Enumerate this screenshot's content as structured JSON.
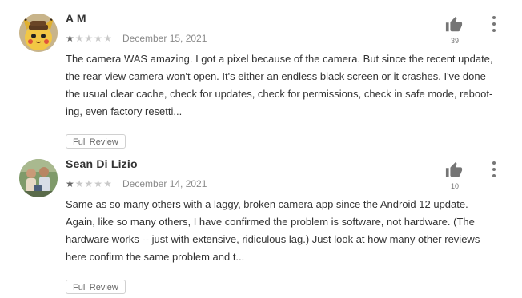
{
  "reviews": [
    {
      "author": "A M",
      "rating": 1,
      "stars": [
        "★",
        "★",
        "★",
        "★",
        "★"
      ],
      "date": "December 15, 2021",
      "text": "The camera WAS amazing. I got a pixel because of the camera. But since the recent update, the rear-view camera won't open. It's either an endless black screen or it crashes. I've done the usual clear cache, check for updates, check for permissions, check in safe mode, reboot-ing, even factory resetti...",
      "helpful_count": "39",
      "full_review_label": "Full Review",
      "avatar_icon": "pikachu-avatar-icon"
    },
    {
      "author": "Sean Di Lizio",
      "rating": 1,
      "stars": [
        "★",
        "★",
        "★",
        "★",
        "★"
      ],
      "date": "December 14, 2021",
      "text": "Same as so many others with a laggy, broken camera app since the Android 12 update. Again, like so many others, I have confirmed the problem is software, not hardware. (The hardware works -- just with extensive, ridiculous lag.) Just look at how many other reviews here confirm the same problem and t...",
      "helpful_count": "10",
      "full_review_label": "Full Review",
      "avatar_icon": "photo-avatar-icon"
    }
  ],
  "colors": {
    "text": "#333333",
    "muted": "#8a8a8a",
    "star_off": "#c9c9c9",
    "star_on": "#666666"
  },
  "icons": {
    "helpful": "thumbs-up-icon",
    "menu": "more-vert-icon"
  }
}
